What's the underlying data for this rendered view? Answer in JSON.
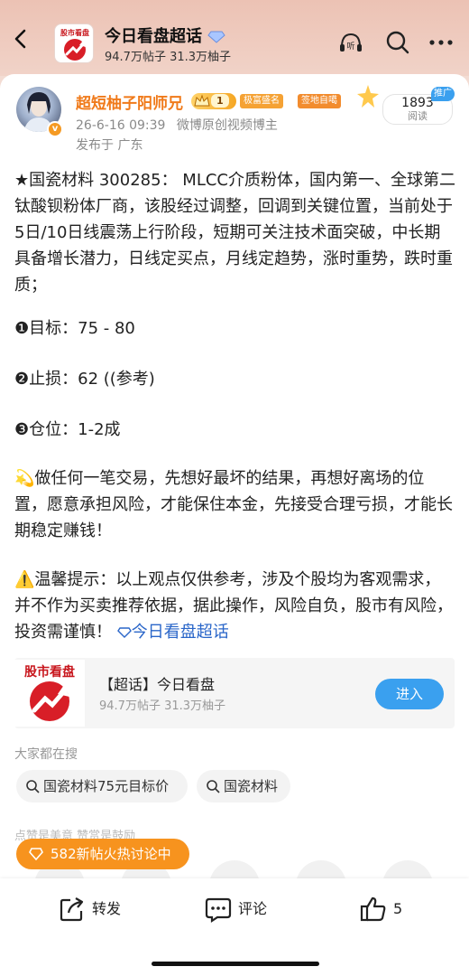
{
  "header": {
    "title": "今日看盘超话",
    "subtitle": "94.7万帖子 31.3万柚子",
    "logo_text": "股市看盘"
  },
  "post": {
    "author": "超短柚子阳师兄",
    "level": "1",
    "tags": [
      "极富盛名",
      "签地自噶"
    ],
    "datetime": "26-6-16 09:39",
    "source": "微博原创视频博主",
    "location": "发布于 广东",
    "read_count": "1893",
    "read_label": "阅读",
    "push_label": "推广",
    "paragraph1": "★国瓷材料 300285： MLCC介质粉体，国内第一、全球第二钛酸钡粉体厂商，该股经过调整，回调到关键位置，当前处于5日/10日线震荡上行阶段，短期可关注技术面突破，中长期具备增长潜力，日线定买点，月线定趋势，涨时重势，跌时重质；",
    "target": "❶目标：75 - 80",
    "stoploss": "❷止损：62 ((参考)",
    "position": "❸仓位：1-2成",
    "paragraph2": "💫做任何一笔交易，先想好最坏的结果，再想好离场的位置，愿意承担风险，才能保住本金，先接受合理亏损，才能长期稳定赚钱！",
    "paragraph3": "⚠️温馨提示：以上观点仅供参考，涉及个股均为客观需求，并不作为买卖推荐依据，据此操作，风险自负，股市有风险，投资需谨慎！",
    "topic_link": "今日看盘超话"
  },
  "topic_card": {
    "logo_text": "股市看盘",
    "name": "【超话】今日看盘",
    "stats": "94.7万帖子 31.3万柚子",
    "enter_label": "进入"
  },
  "search": {
    "label": "大家都在搜",
    "chips": [
      "国瓷材料75元目标价",
      "国瓷材料"
    ]
  },
  "praise_text": "点赞是美意  赞赏是鼓励",
  "hot_pill": "582新帖火热讨论中",
  "bottom_bar": {
    "repost": "转发",
    "comment": "评论",
    "like_count": "5"
  },
  "colors": {
    "accent_blue": "#3aa0ef",
    "author_orange": "#f07a1a",
    "hot_orange": "#f7931e",
    "header_bg": "#ecc2b4"
  }
}
